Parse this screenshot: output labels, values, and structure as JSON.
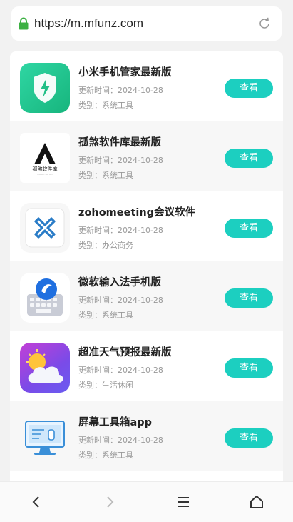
{
  "browser": {
    "url": "https://m.mfunz.com",
    "lock_icon": "lock-icon",
    "reload_icon": "reload-icon"
  },
  "list": {
    "update_prefix": "更新时间：",
    "category_prefix": "类别：",
    "items": [
      {
        "title": "小米手机管家最新版",
        "updated": "更新时间：2024-10-28",
        "category": "类别：系统工具",
        "button": "查看",
        "icon": "security-shield-icon"
      },
      {
        "title": "孤煞软件库最新版",
        "updated": "更新时间：2024-10-28",
        "category": "类别：系统工具",
        "button": "查看",
        "icon": "app-library-logo-icon",
        "icon_caption": "孤煞软件库"
      },
      {
        "title": "zohomeeting会议软件",
        "updated": "更新时间：2024-10-28",
        "category": "类别：办公商务",
        "button": "查看",
        "icon": "zoho-meeting-icon"
      },
      {
        "title": "微软输入法手机版",
        "updated": "更新时间：2024-10-28",
        "category": "类别：系统工具",
        "button": "查看",
        "icon": "keyboard-icon"
      },
      {
        "title": "超准天气预报最新版",
        "updated": "更新时间：2024-10-28",
        "category": "类别：生活休闲",
        "button": "查看",
        "icon": "weather-icon"
      },
      {
        "title": "屏幕工具箱app",
        "updated": "更新时间：2024-10-28",
        "category": "类别：系统工具",
        "button": "查看",
        "icon": "screen-tool-icon"
      }
    ]
  },
  "nav": {
    "back_icon": "back-arrow-icon",
    "forward_icon": "forward-arrow-icon",
    "menu_icon": "menu-icon",
    "home_icon": "home-icon"
  },
  "colors": {
    "accent": "#1ccfc0",
    "lock": "#3cb043"
  }
}
